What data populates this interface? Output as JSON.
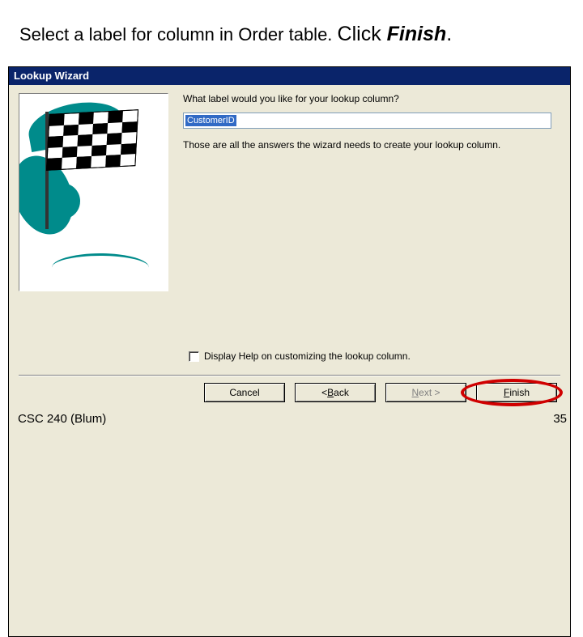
{
  "instruction": {
    "part1": "Select a label for column in Order table. ",
    "part2": "Click ",
    "part3": "Finish",
    "part4": "."
  },
  "dialog": {
    "title": "Lookup Wizard",
    "prompt1": "What label would you like for your lookup column?",
    "input_value": "CustomerID",
    "prompt2": "Those are all the answers the wizard needs to create your lookup column.",
    "help_label": "Display Help on customizing the lookup column.",
    "buttons": {
      "cancel": "Cancel",
      "back_prefix": "< ",
      "back_ul": "B",
      "back_rest": "ack",
      "next_ul": "N",
      "next_rest": "ext >",
      "finish_ul": "F",
      "finish_rest": "inish"
    }
  },
  "footer": {
    "left": "CSC 240 (Blum)",
    "right": "35"
  }
}
